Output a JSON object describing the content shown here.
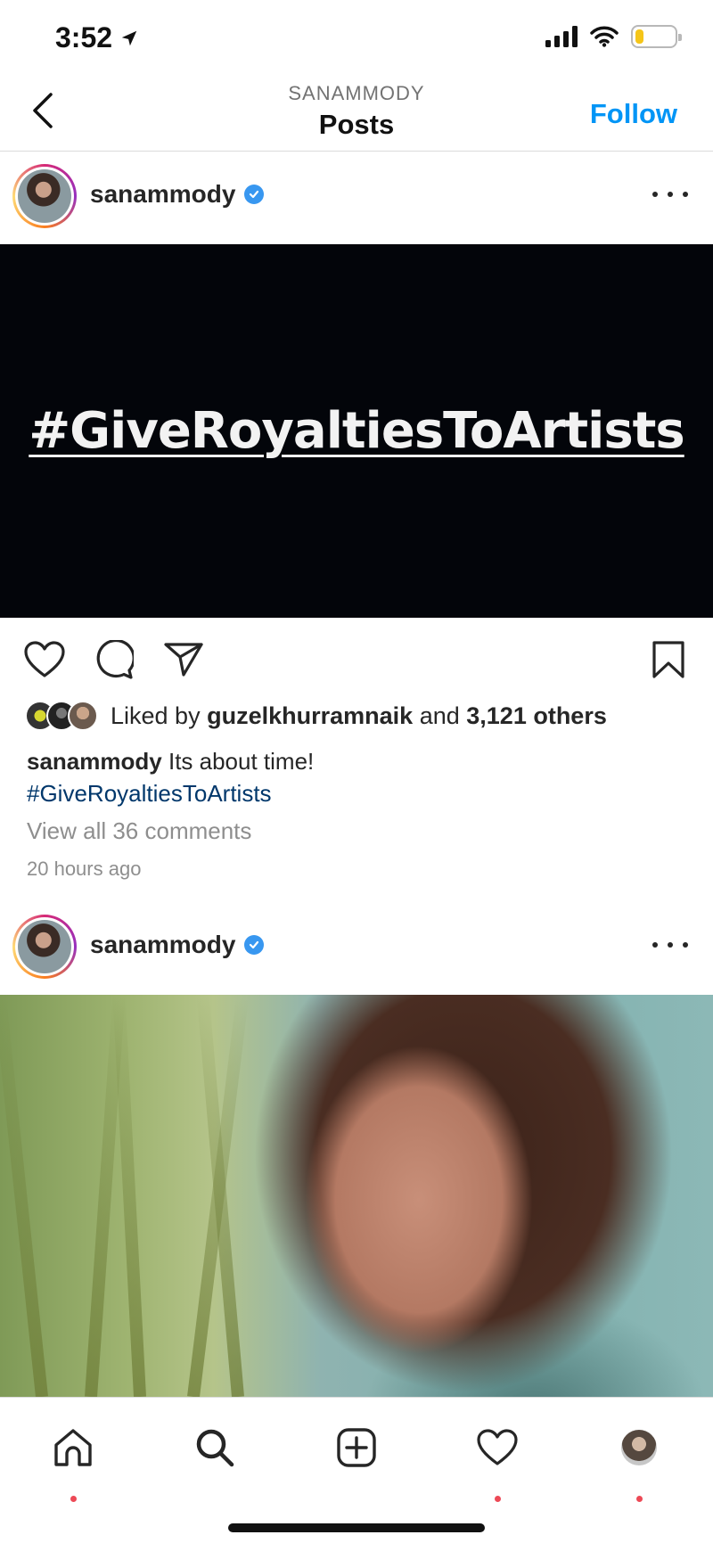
{
  "status_bar": {
    "time": "3:52",
    "battery_level": 0.2,
    "battery_color": "#f5c518"
  },
  "nav": {
    "subtitle": "SANAMMODY",
    "title": "Posts",
    "follow_label": "Follow"
  },
  "posts": [
    {
      "username": "sanammody",
      "image_text": "#GiveRoyaltiesToArtists",
      "liked_by_prefix": "Liked by",
      "liked_by_user": "guzelkhurramnaik",
      "liked_by_and": "and",
      "liked_by_others": "3,121 others",
      "caption_user": "sanammody",
      "caption_text": "Its about time!",
      "caption_hashtag": "#GiveRoyaltiesToArtists",
      "view_comments": "View all 36 comments",
      "time_ago": "20 hours ago"
    },
    {
      "username": "sanammody"
    }
  ],
  "tabbar": {
    "items": [
      {
        "icon": "home-icon",
        "has_dot": true
      },
      {
        "icon": "search-icon",
        "has_dot": false
      },
      {
        "icon": "add-post-icon",
        "has_dot": false
      },
      {
        "icon": "heart-icon",
        "has_dot": true
      },
      {
        "icon": "profile-avatar",
        "has_dot": true
      }
    ]
  },
  "colors": {
    "accent": "#0095f6",
    "hashtag": "#00376b",
    "muted": "#8e8e8e",
    "notification_dot": "#ed4956",
    "verified": "#3897f0"
  }
}
